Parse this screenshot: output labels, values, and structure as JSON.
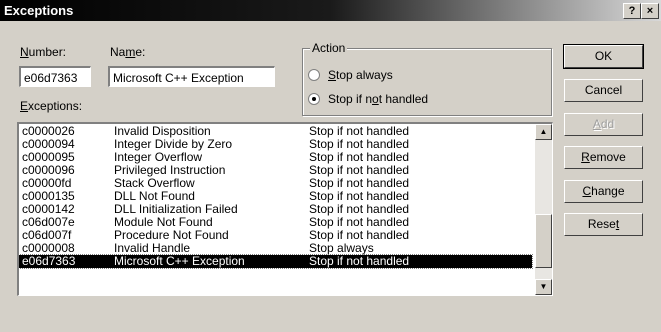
{
  "window": {
    "title": "Exceptions",
    "help_button": "?",
    "close_button": "×"
  },
  "fields": {
    "number_label_accel": "N",
    "number_label_rest": "umber:",
    "name_label_a": "Na",
    "name_label_accel": "m",
    "name_label_rest": "e:",
    "number_value": "e06d7363",
    "name_value": "Microsoft C++ Exception"
  },
  "action": {
    "legend": "Action",
    "stop_always_accel": "S",
    "stop_always_rest": "top always",
    "stop_if_a": "Stop if n",
    "stop_if_accel": "o",
    "stop_if_rest": "t handled",
    "selected": "stop_if_not_handled"
  },
  "list": {
    "label_accel": "E",
    "label_rest": "xceptions:",
    "rows": [
      [
        "c0000026",
        "Invalid Disposition",
        "Stop if not handled"
      ],
      [
        "c0000094",
        "Integer Divide by Zero",
        "Stop if not handled"
      ],
      [
        "c0000095",
        "Integer Overflow",
        "Stop if not handled"
      ],
      [
        "c0000096",
        "Privileged Instruction",
        "Stop if not handled"
      ],
      [
        "c00000fd",
        "Stack Overflow",
        "Stop if not handled"
      ],
      [
        "c0000135",
        "DLL Not Found",
        "Stop if not handled"
      ],
      [
        "c0000142",
        "DLL Initialization Failed",
        "Stop if not handled"
      ],
      [
        "c06d007e",
        "Module Not Found",
        "Stop if not handled"
      ],
      [
        "c06d007f",
        "Procedure Not Found",
        "Stop if not handled"
      ],
      [
        "c0000008",
        "Invalid Handle",
        "Stop always"
      ],
      [
        "e06d7363",
        "Microsoft C++ Exception",
        "Stop if not handled"
      ]
    ],
    "selected_index": 10
  },
  "buttons": {
    "ok": "OK",
    "cancel": "Cancel",
    "add_accel": "A",
    "add_rest": "dd",
    "remove_accel": "R",
    "remove_rest": "emove",
    "change_accel": "C",
    "change_rest": "hange",
    "reset_a": "Rese",
    "reset_accel": "t"
  }
}
